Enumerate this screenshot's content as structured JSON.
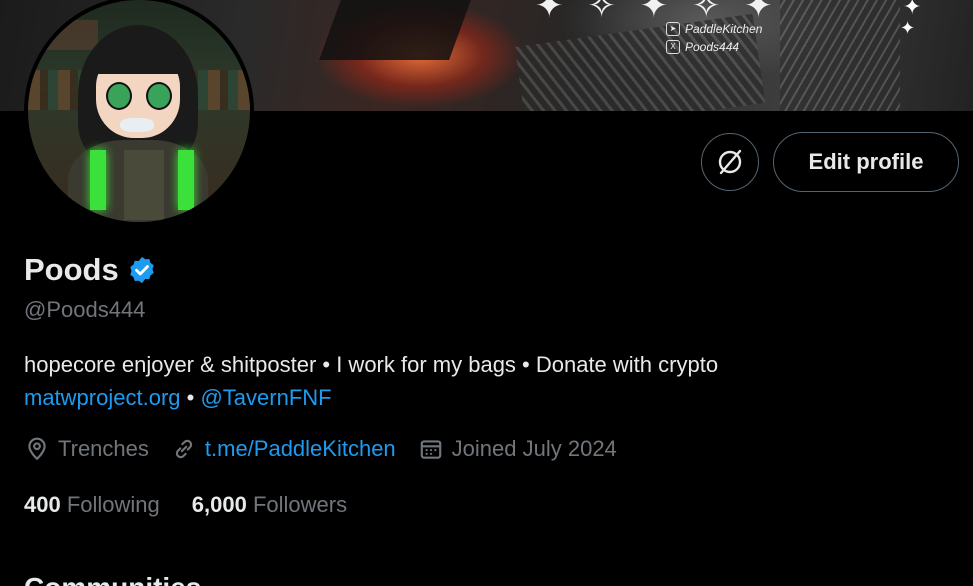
{
  "banner": {
    "socials": [
      {
        "icon": "telegram-icon",
        "text": "PaddleKitchen"
      },
      {
        "icon": "x-logo-icon",
        "text": "Poods444"
      }
    ]
  },
  "actions": {
    "icon_button": "grok-icon",
    "edit_profile_label": "Edit profile"
  },
  "profile": {
    "name": "Poods",
    "handle": "@Poods444",
    "bio_text": "hopecore enjoyer & shitposter • I work for my bags •  Donate with crypto",
    "bio_link1": "matwproject.org",
    "bio_sep": " • ",
    "bio_link2": "@TavernFNF",
    "location": "Trenches",
    "website": "t.me/PaddleKitchen",
    "joined": "Joined July 2024"
  },
  "stats": {
    "following_count": "400",
    "following_label": "Following",
    "followers_count": "6,000",
    "followers_label": "Followers"
  },
  "next_section_heading": "Communities",
  "colors": {
    "accent": "#1d9bf0",
    "muted": "#71767b",
    "text": "#e7e9ea",
    "background": "#000000"
  }
}
